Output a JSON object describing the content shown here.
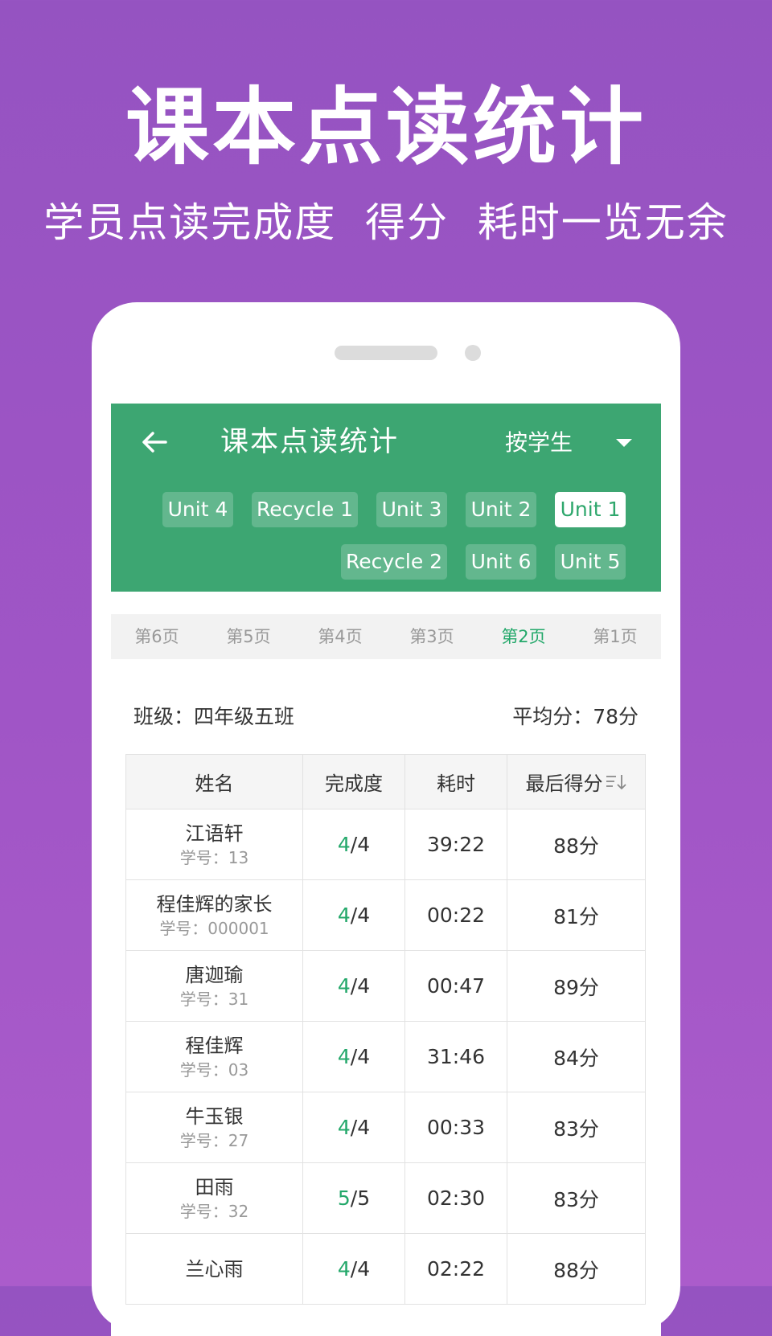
{
  "promo": {
    "headline": "课本点读统计",
    "subline": "学员点读完成度  得分  耗时一览无余"
  },
  "appbar": {
    "title": "课本点读统计",
    "mode_label": "按学生",
    "back_icon": "arrow-left-icon",
    "dropdown_icon": "caret-down-icon",
    "color": "#3da672"
  },
  "units": [
    {
      "label": "Unit 4",
      "active": false
    },
    {
      "label": "Recycle 1",
      "active": false
    },
    {
      "label": "Unit 3",
      "active": false
    },
    {
      "label": "Unit 2",
      "active": false
    },
    {
      "label": "Unit 1",
      "active": true
    },
    {
      "label": "Recycle 2",
      "active": false
    },
    {
      "label": "Unit 6",
      "active": false
    },
    {
      "label": "Unit 5",
      "active": false
    }
  ],
  "pages": [
    {
      "label": "第6页",
      "active": false
    },
    {
      "label": "第5页",
      "active": false
    },
    {
      "label": "第4页",
      "active": false
    },
    {
      "label": "第3页",
      "active": false
    },
    {
      "label": "第2页",
      "active": true
    },
    {
      "label": "第1页",
      "active": false
    }
  ],
  "summary": {
    "class_label": "班级：四年级五班",
    "average_label": "平均分：78分"
  },
  "table": {
    "headers": [
      "姓名",
      "完成度",
      "耗时",
      "最后得分"
    ],
    "sort_icon": "sort-icon",
    "rows": [
      {
        "name": "江语轩",
        "student_id": "学号：13",
        "done": "4",
        "total": "/4",
        "time": "39:22",
        "score": "88分"
      },
      {
        "name": "程佳辉的家长",
        "student_id": "学号：000001",
        "done": "4",
        "total": "/4",
        "time": "00:22",
        "score": "81分"
      },
      {
        "name": "唐迦瑜",
        "student_id": "学号：31",
        "done": "4",
        "total": "/4",
        "time": "00:47",
        "score": "89分"
      },
      {
        "name": "程佳辉",
        "student_id": "学号：03",
        "done": "4",
        "total": "/4",
        "time": "31:46",
        "score": "84分"
      },
      {
        "name": "牛玉银",
        "student_id": "学号：27",
        "done": "4",
        "total": "/4",
        "time": "00:33",
        "score": "83分"
      },
      {
        "name": "田雨",
        "student_id": "学号：32",
        "done": "5",
        "total": "/5",
        "time": "02:30",
        "score": "83分"
      },
      {
        "name": "兰心雨",
        "student_id": "",
        "done": "4",
        "total": "/4",
        "time": "02:22",
        "score": "88分"
      }
    ]
  },
  "colors": {
    "accent_green": "#23a86a",
    "background_purple": "#9b55c4"
  }
}
